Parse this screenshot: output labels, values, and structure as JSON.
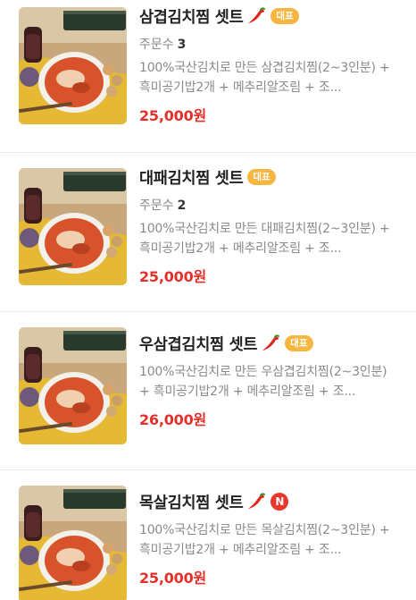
{
  "colors": {
    "price": "#e3302a",
    "badge": "#f6b640",
    "new_badge": "#e8382c",
    "muted": "#8a8a8a"
  },
  "items": [
    {
      "title": "삼겹김치찜 셋트",
      "icon": "chili-pepper-icon",
      "badge": "대표",
      "orders_label": "주문수",
      "orders_count": "3",
      "description": "100%국산김치로 만든 삼겹김치찜(2~3인분) + 흑미공기밥2개 + 메추리알조림 + 조...",
      "price": "25,000원"
    },
    {
      "title": "대패김치찜 셋트",
      "badge": "대표",
      "orders_label": "주문수",
      "orders_count": "2",
      "description": "100%국산김치로 만든 대패김치찜(2~3인분) + 흑미공기밥2개 + 메추리알조림 + 조...",
      "price": "25,000원"
    },
    {
      "title": "우삼겹김치찜 셋트",
      "icon": "chili-pepper-icon",
      "badge": "대표",
      "description": "100%국산김치로 만든 우삼겹김치찜(2~3인분) + 흑미공기밥2개 + 메추리알조림 + 조...",
      "price": "26,000원"
    },
    {
      "title": "목살김치찜 셋트",
      "icon": "chili-pepper-icon",
      "badge": "N",
      "description": "100%국산김치로 만든 목살김치찜(2~3인분) + 흑미공기밥2개 + 메추리알조림 + 조...",
      "price": "25,000원"
    }
  ]
}
